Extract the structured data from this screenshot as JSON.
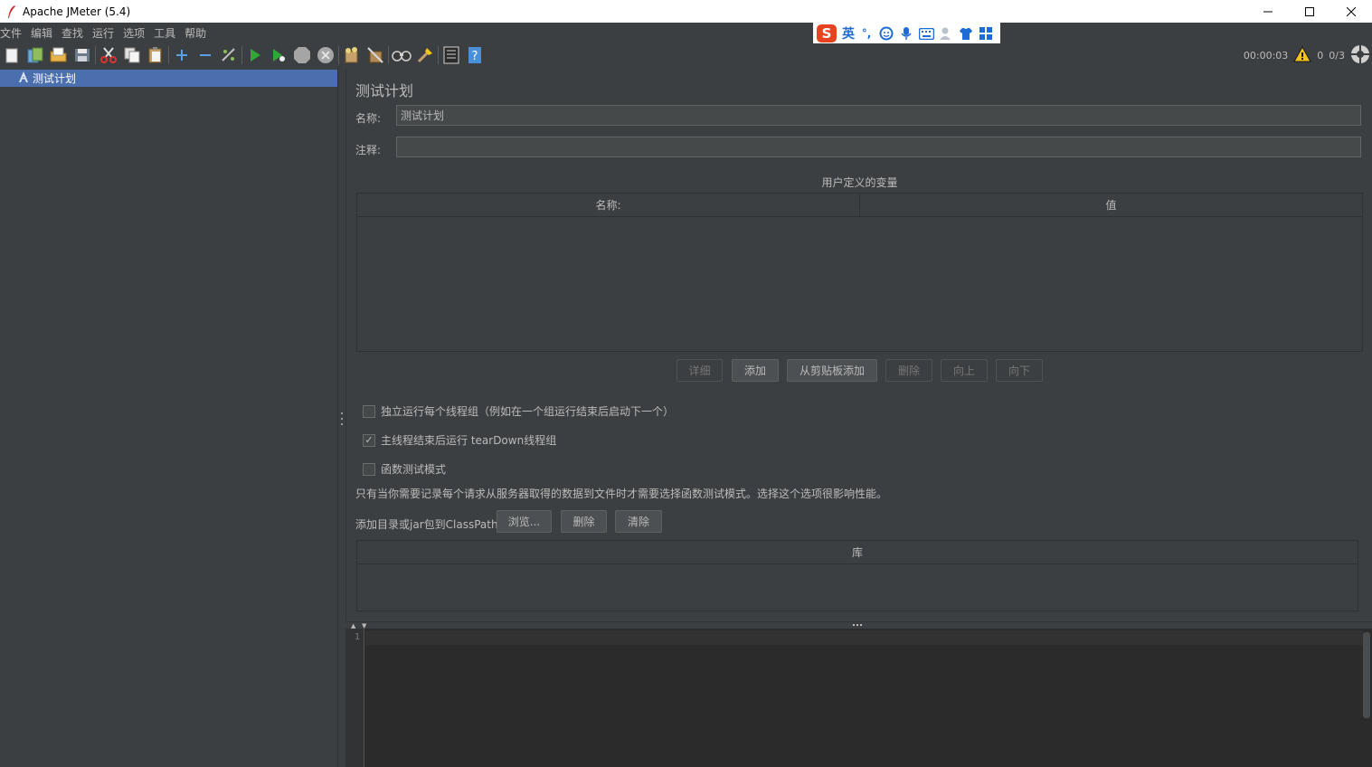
{
  "window": {
    "title": "Apache JMeter (5.4)",
    "controls": [
      "minimize",
      "maximize",
      "close"
    ]
  },
  "menu": {
    "items": [
      "文件",
      "编辑",
      "查找",
      "运行",
      "选项",
      "工具",
      "帮助"
    ]
  },
  "ime": {
    "language": "英",
    "punct": "°,"
  },
  "toolbar": {
    "buttons": [
      "new-icon",
      "templates-icon",
      "open-icon",
      "save-icon",
      "cut-icon",
      "copy-icon",
      "paste-icon",
      "expand-icon",
      "collapse-icon",
      "toggle-icon",
      "start-icon",
      "start-no-pauses-icon",
      "stop-icon",
      "shutdown-icon",
      "clear-icon",
      "clear-all-icon",
      "search-icon",
      "reset-search-icon",
      "function-helper-icon",
      "help-icon"
    ],
    "elapsed_time": "00:00:03",
    "warning_count": "0",
    "threads": "0/3"
  },
  "tree": {
    "root_label": "测试计划"
  },
  "test_plan": {
    "title": "测试计划",
    "name_label": "名称:",
    "name_value": "测试计划",
    "comment_label": "注释:",
    "comment_value": "",
    "user_vars_caption": "用户定义的变量",
    "columns": [
      "名称:",
      "值"
    ],
    "rows": [],
    "buttons": {
      "detail": "详细",
      "add": "添加",
      "add_from_clipboard": "从剪贴板添加",
      "delete": "删除",
      "up": "向上",
      "down": "向下"
    },
    "options": {
      "run_groups_consecutively": {
        "label": "独立运行每个线程组（例如在一个组运行结束后启动下一个）",
        "checked": false
      },
      "teardown_after_shutdown": {
        "label": "主线程结束后运行 tearDown线程组",
        "checked": true
      },
      "functional_mode": {
        "label": "函数测试模式",
        "checked": false
      }
    },
    "functional_hint": "只有当你需要记录每个请求从服务器取得的数据到文件时才需要选择函数测试模式。选择这个选项很影响性能。",
    "classpath_label": "添加目录或jar包到ClassPath",
    "classpath_buttons": {
      "browse": "浏览...",
      "delete": "删除",
      "clear": "清除"
    },
    "library_column": "库",
    "libraries": []
  },
  "log_panel": {
    "line_number": "1"
  },
  "colors": {
    "background": "#3c3f41",
    "selection": "#4b6eaf",
    "editor_background": "#2b2b2b",
    "text": "#bbbbbb",
    "start_green": "#2fa836",
    "warning_yellow": "#f0c419"
  }
}
